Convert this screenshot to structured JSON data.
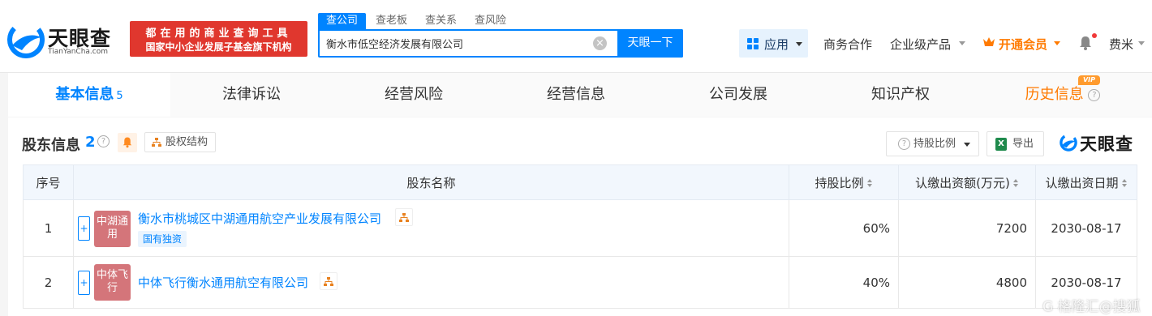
{
  "header": {
    "logo": {
      "name_cn": "天眼查",
      "name_en": "TianYanCha.com"
    },
    "slogan": {
      "line1": "都在用的商业查询工具",
      "line2": "国家中小企业发展子基金旗下机构"
    },
    "search": {
      "tabs": [
        "查公司",
        "查老板",
        "查关系",
        "查风险"
      ],
      "active_tab": "查公司",
      "query": "衡水市低空经济发展有限公司",
      "button": "天眼一下"
    },
    "nav": {
      "app": "应用",
      "business": "商务合作",
      "enterprise": "企业级产品",
      "vip": "开通会员",
      "user": "费米"
    }
  },
  "tabs": [
    {
      "label": "基本信息",
      "count": "5",
      "active": true
    },
    {
      "label": "法律诉讼"
    },
    {
      "label": "经营风险"
    },
    {
      "label": "经营信息"
    },
    {
      "label": "公司发展"
    },
    {
      "label": "知识产权"
    },
    {
      "label": "历史信息",
      "badge": "VIP"
    }
  ],
  "section": {
    "title": "股东信息",
    "count": "2",
    "equity_structure": "股权结构",
    "ratio_filter": "持股比例",
    "export": "导出",
    "brand": "天眼查"
  },
  "table": {
    "headers": [
      "序号",
      "股东名称",
      "持股比例",
      "认缴出资额(万元)",
      "认缴出资日期"
    ],
    "rows": [
      {
        "index": "1",
        "avatar": "中湖通用",
        "name": "衡水市桃城区中湖通用航空产业发展有限公司",
        "tag": "国有独资",
        "ratio": "60%",
        "amount": "7200",
        "date": "2030-08-17"
      },
      {
        "index": "2",
        "avatar": "中体飞行",
        "name": "中体飞行衡水通用航空有限公司",
        "tag": "",
        "ratio": "40%",
        "amount": "4800",
        "date": "2030-08-17"
      }
    ]
  },
  "watermark": "G 格隆汇@搜狐",
  "colors": {
    "brand_blue": "#0084ff",
    "slogan_red": "#e0372e",
    "vip_orange": "#ff7a00",
    "avatar_red": "#d4757a"
  }
}
